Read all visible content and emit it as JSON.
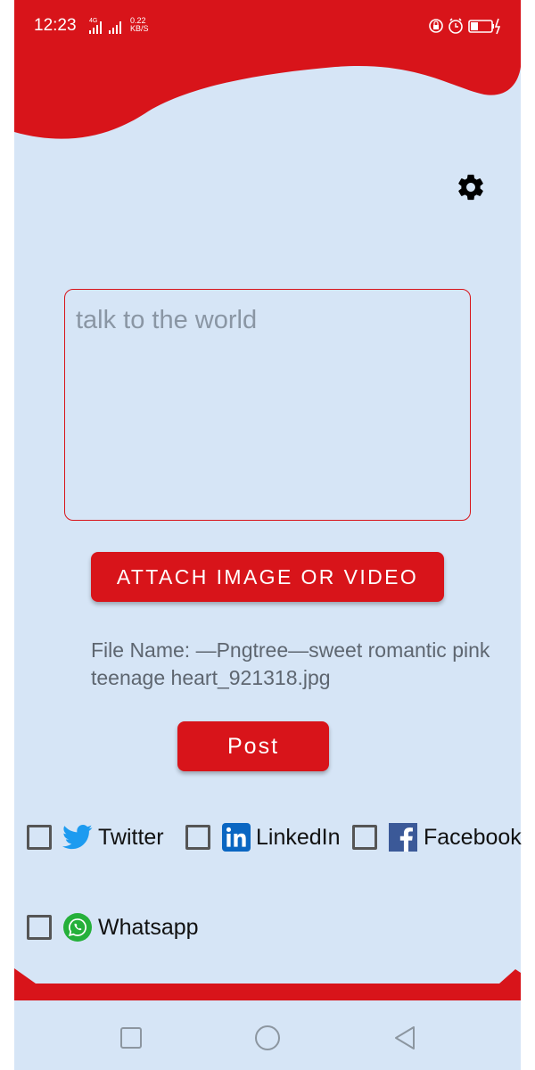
{
  "status_bar": {
    "time": "12:23",
    "network_type": "4G",
    "speed_value": "0.22",
    "speed_unit": "KB/S"
  },
  "composer": {
    "placeholder": "talk to the world",
    "value": ""
  },
  "attach_button": {
    "label": "ATTACH IMAGE OR VIDEO"
  },
  "file_name": {
    "text": "File Name: —Pngtree—sweet romantic pink\nteenage heart_921318.jpg"
  },
  "post_button": {
    "label": "Post"
  },
  "share_options": [
    {
      "label": "Twitter",
      "icon": "twitter-icon",
      "checked": false,
      "color": "#1d9bf0"
    },
    {
      "label": "LinkedIn",
      "icon": "linkedin-icon",
      "checked": false,
      "color": "#0a66c2"
    },
    {
      "label": "Facebook",
      "icon": "facebook-icon",
      "checked": false,
      "color": "#3b5998"
    },
    {
      "label": "Whatsapp",
      "icon": "whatsapp-icon",
      "checked": false,
      "color": "#25b03a"
    }
  ],
  "colors": {
    "accent": "#d8141a",
    "background": "#d6e5f6",
    "file_name_text": "#5e6670",
    "placeholder_text": "#8a96a4"
  },
  "icons": {
    "settings": "gear-icon",
    "nav_recents": "square-icon",
    "nav_home": "circle-icon",
    "nav_back": "triangle-back-icon"
  }
}
